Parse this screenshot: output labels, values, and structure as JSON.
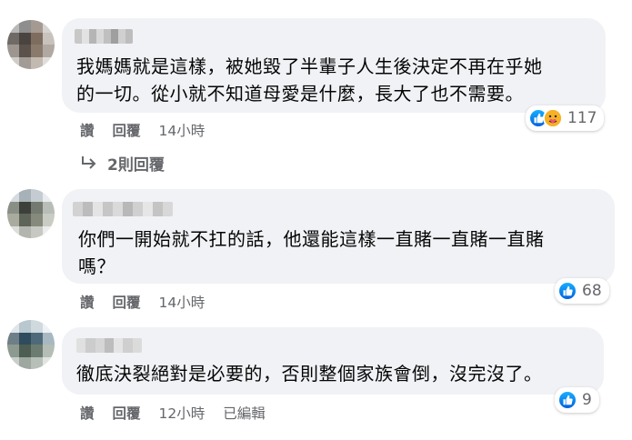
{
  "comments": [
    {
      "text": "我媽媽就是這樣，被她毀了半輩子人生後決定不再在乎她\n的一切。從小就不知道母愛是什麼，長大了也不需要。",
      "like_label": "讚",
      "reply_label": "回覆",
      "time": "14小時",
      "reaction_icons": [
        "like-icon",
        "care-icon"
      ],
      "reaction_count": "117",
      "replies_label": "2則回覆"
    },
    {
      "text": "你們一開始就不扛的話，他還能這樣一直賭一直賭一直賭\n嗎？",
      "like_label": "讚",
      "reply_label": "回覆",
      "time": "14小時",
      "reaction_icons": [
        "like-icon"
      ],
      "reaction_count": "68"
    },
    {
      "text": "徹底決裂絕對是必要的，否則整個家族會倒，沒完沒了。",
      "like_label": "讚",
      "reply_label": "回覆",
      "time": "12小時",
      "edited_label": "已編輯",
      "reaction_icons": [
        "like-icon"
      ],
      "reaction_count": "9"
    }
  ],
  "colors": {
    "bubble": "#f0f2f5",
    "like_blue": "#1877f2",
    "meta_gray": "#65676b",
    "care_yellow": "#f7b125"
  }
}
